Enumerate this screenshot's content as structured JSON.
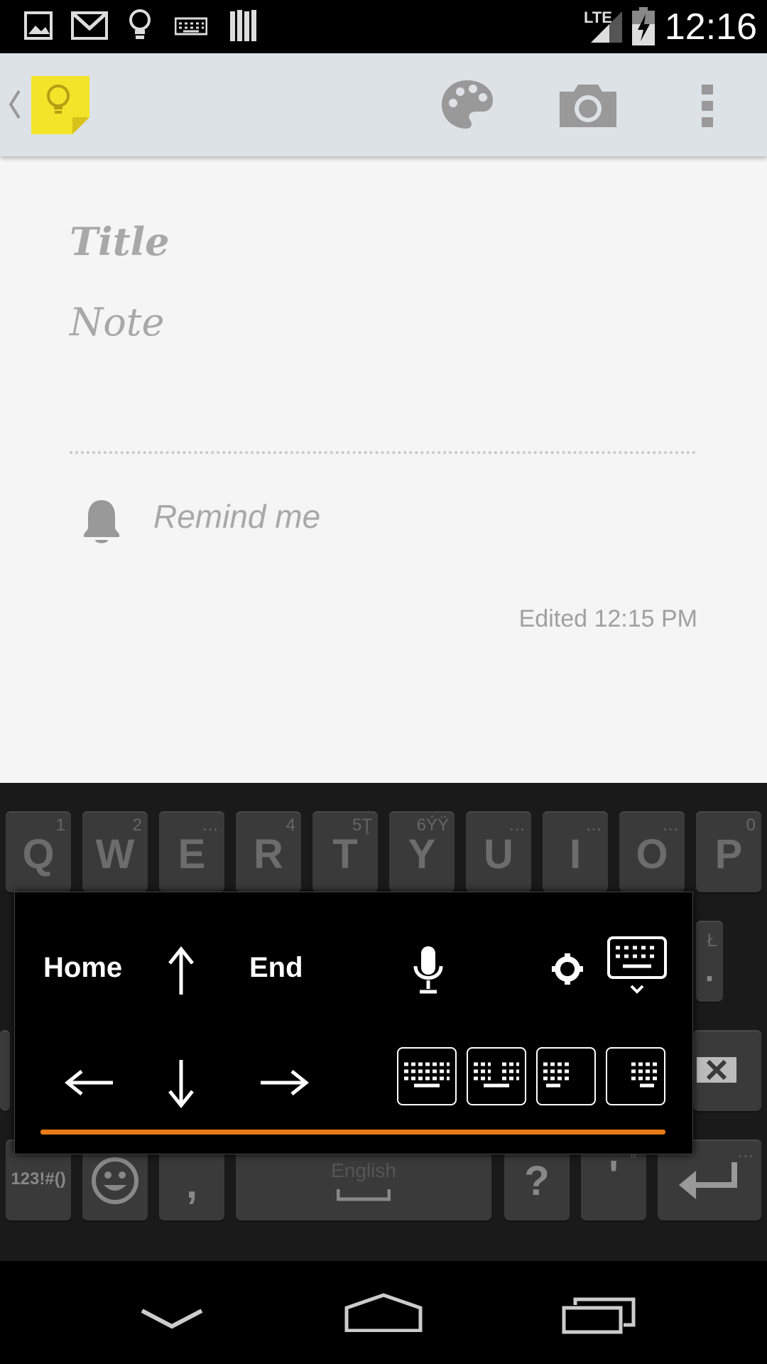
{
  "status_bar": {
    "icons": [
      "gallery-icon",
      "gmail-icon",
      "keep-bulb-icon",
      "keyboard-icon",
      "library-icon"
    ],
    "network": "LTE",
    "time": "12:16"
  },
  "action_bar": {
    "back_icon": "back-chevron-icon",
    "app_icon": "keep-app-icon",
    "actions": [
      "palette-icon",
      "camera-icon",
      "overflow-menu-icon"
    ]
  },
  "note": {
    "title_placeholder": "Title",
    "note_placeholder": "Note",
    "remind_label": "Remind me",
    "edited": "Edited 12:15 PM"
  },
  "keyboard": {
    "row1": [
      {
        "label": "Q",
        "hint": "1"
      },
      {
        "label": "W",
        "hint": "2"
      },
      {
        "label": "E",
        "hint": "…"
      },
      {
        "label": "R",
        "hint": "4"
      },
      {
        "label": "T",
        "hint": "5Ţ"
      },
      {
        "label": "Y",
        "hint": "6ÝŸ"
      },
      {
        "label": "U",
        "hint": "…"
      },
      {
        "label": "I",
        "hint": "…"
      },
      {
        "label": "O",
        "hint": "…"
      },
      {
        "label": "P",
        "hint": "0"
      }
    ],
    "side_hint": "Ł",
    "side_period": ".",
    "bottom_row": {
      "symbols": "123!#()",
      "emoji_icon": "smiley-icon",
      "comma": ",",
      "space_label": "English",
      "question": "?",
      "apostrophe": "'",
      "apostrophe_hint": "\"",
      "enter_icon": "enter-icon"
    },
    "backspace_icon": "backspace-icon"
  },
  "popup": {
    "home": "Home",
    "end": "End",
    "up_icon": "arrow-up-icon",
    "down_icon": "arrow-down-icon",
    "left_icon": "arrow-left-icon",
    "right_icon": "arrow-right-icon",
    "mic_icon": "microphone-icon",
    "settings_icon": "settings-icon",
    "hide_keyboard_icon": "hide-keyboard-icon",
    "modes": [
      "full-keyboard-icon",
      "split-keyboard-icon",
      "left-keyboard-icon",
      "right-keyboard-icon"
    ],
    "accent_color": "#e87a17"
  },
  "nav_bar": {
    "back": "nav-back-icon",
    "home": "nav-home-icon",
    "recents": "nav-recents-icon"
  }
}
